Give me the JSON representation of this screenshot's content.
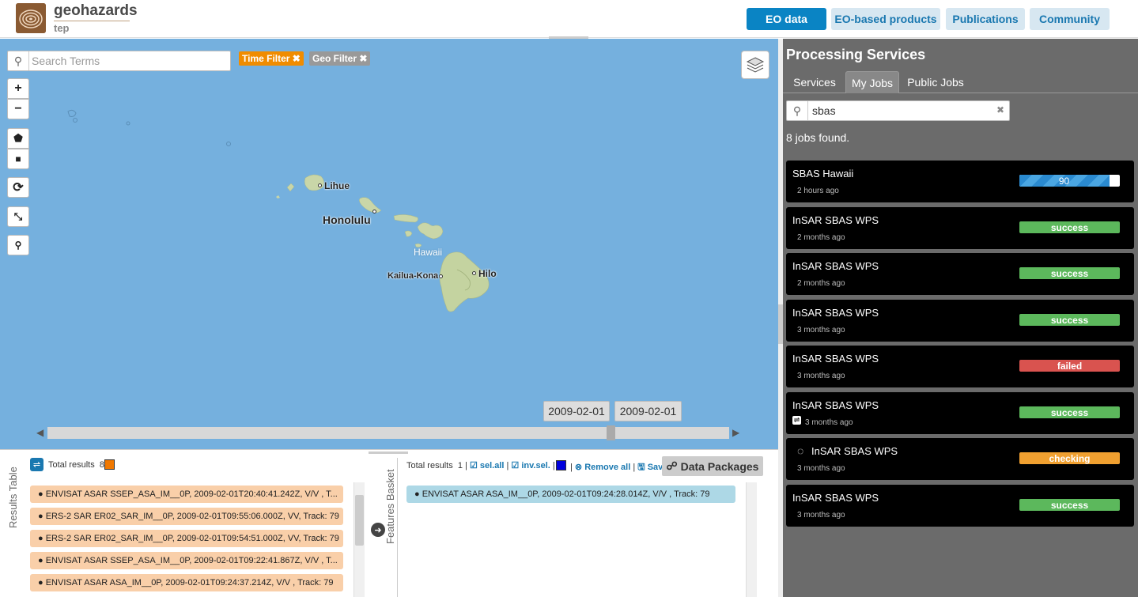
{
  "brand": {
    "title": "geohazards",
    "subtitle": "tep"
  },
  "nav": [
    {
      "label": "EO data",
      "active": true
    },
    {
      "label": "EO-based products",
      "active": false
    },
    {
      "label": "Publications",
      "active": false
    },
    {
      "label": "Community",
      "active": false
    }
  ],
  "map": {
    "search_placeholder": "Search Terms",
    "chips": [
      {
        "label": "Time Filter ✖",
        "color": "#f08c00"
      },
      {
        "label": "Geo Filter ✖",
        "color": "#999999"
      }
    ],
    "cities": {
      "lihue": "Lihue",
      "honolulu": "Honolulu",
      "hawaii": "Hawaii",
      "kailua": "Kailua-Kona",
      "hilo": "Hilo"
    },
    "timeline": {
      "start": "2009-02-01",
      "end": "2009-02-01"
    }
  },
  "results": {
    "panel_label": "Results Table",
    "total_label": "Total results",
    "total": "8",
    "color": "#f07800",
    "rows": [
      "ENVISAT ASAR SSEP_ASA_IM__0P, 2009-02-01T20:40:41.242Z, V/V , T...",
      "ERS-2 SAR ER02_SAR_IM__0P, 2009-02-01T09:55:06.000Z, VV, Track: 79",
      "ERS-2 SAR ER02_SAR_IM__0P, 2009-02-01T09:54:51.000Z, VV, Track: 79",
      "ENVISAT ASAR SSEP_ASA_IM__0P, 2009-02-01T09:22:41.867Z, V/V , T...",
      "ENVISAT ASAR ASA_IM__0P, 2009-02-01T09:24:37.214Z, V/V , Track: 79"
    ]
  },
  "basket": {
    "panel_label": "Features Basket",
    "total_label": "Total results",
    "total": "1",
    "sel_all": "sel.all",
    "inv_sel": "inv.sel.",
    "color": "#0000dd",
    "remove_all": "Remove all",
    "save": "Save",
    "data_packages": "Data Packages",
    "rows": [
      "ENVISAT ASAR ASA_IM__0P, 2009-02-01T09:24:28.014Z, V/V , Track: 79"
    ]
  },
  "processing": {
    "title": "Processing Services",
    "tabs": [
      {
        "label": "Services",
        "active": false
      },
      {
        "label": "My Jobs",
        "active": true
      },
      {
        "label": "Public Jobs",
        "active": false
      }
    ],
    "search_value": "sbas",
    "jobs_found": "8 jobs found.",
    "jobs": [
      {
        "name": "SBAS Hawaii",
        "time": "2 hours ago",
        "status": "90",
        "kind": "progress",
        "progress": 0.9
      },
      {
        "name": "InSAR SBAS WPS",
        "time": "2 months ago",
        "status": "success",
        "kind": "success"
      },
      {
        "name": "InSAR SBAS WPS",
        "time": "2 months ago",
        "status": "success",
        "kind": "success"
      },
      {
        "name": "InSAR SBAS WPS",
        "time": "3 months ago",
        "status": "success",
        "kind": "success"
      },
      {
        "name": "InSAR SBAS WPS",
        "time": "3 months ago",
        "status": "failed",
        "kind": "failed"
      },
      {
        "name": "InSAR SBAS WPS",
        "time": "3 months ago",
        "status": "success",
        "kind": "success",
        "shared": true
      },
      {
        "name": "InSAR SBAS WPS",
        "time": "3 months ago",
        "status": "checking",
        "kind": "checking",
        "spinner": true
      },
      {
        "name": "InSAR SBAS WPS",
        "time": "3 months ago",
        "status": "success",
        "kind": "success"
      }
    ],
    "status_colors": {
      "success": "#5cb85c",
      "failed": "#d9534f",
      "checking": "#f0a030"
    }
  }
}
